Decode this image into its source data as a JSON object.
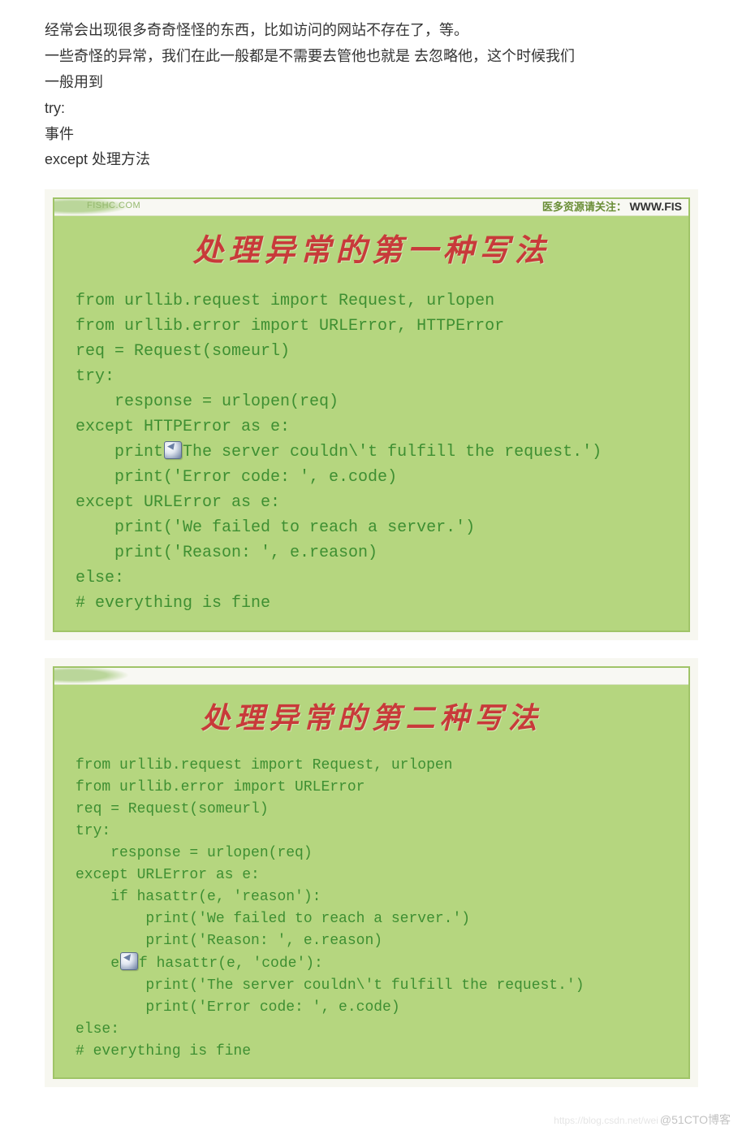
{
  "intro": {
    "lines": [
      "经常会出现很多奇奇怪怪的东西，比如访问的网站不存在了，等。",
      "一些奇怪的异常，我们在此一般都是不需要去管他也就是 去忽略他，这个时候我们",
      "一般用到",
      "try:",
      "    事件",
      "except 处理方法"
    ]
  },
  "slide1": {
    "top_domain": "FISHC.COM",
    "top_note_cn": "医多资源请关注：",
    "top_note_www": "WWW.FIS",
    "title": "处理异常的第一种写法",
    "code_before_icon": "from urllib.request import Request, urlopen\nfrom urllib.error import URLError, HTTPError\nreq = Request(someurl)\ntry:\n    response = urlopen(req)\nexcept HTTPError as e:\n    print",
    "code_after_icon": "The server couldn\\'t fulfill the request.')\n    print('Error code: ', e.code)\nexcept URLError as e:\n    print('We failed to reach a server.')\n    print('Reason: ', e.reason)\nelse:\n# everything is fine"
  },
  "slide2": {
    "title": "处理异常的第二种写法",
    "code_before_icon": "from urllib.request import Request, urlopen\nfrom urllib.error import URLError\nreq = Request(someurl)\ntry:\n    response = urlopen(req)\nexcept URLError as e:\n    if hasattr(e, 'reason'):\n        print('We failed to reach a server.')\n        print('Reason: ', e.reason)\n    e",
    "code_mid": "f hasattr(e, 'code'):",
    "code_after": "\n        print('The server couldn\\'t fulfill the request.')\n        print('Error code: ', e.code)\nelse:\n# everything is fine"
  },
  "watermark": {
    "faint": "https://blog.csdn.net/wei",
    "text": "@51CTO博客"
  }
}
